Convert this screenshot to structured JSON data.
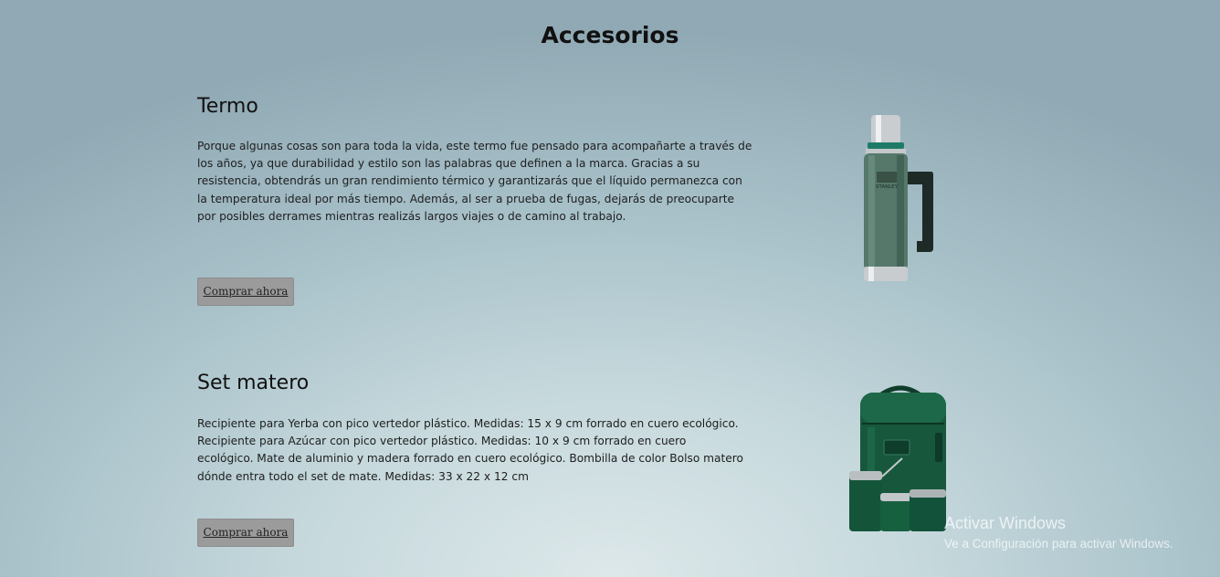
{
  "page": {
    "title": "Accesorios"
  },
  "products": [
    {
      "name": "Termo",
      "description": "Porque algunas cosas son para toda la vida, este termo fue pensado para acompañarte a través de los años, ya que durabilidad y estilo son las palabras que definen a la marca. Gracias a su resistencia, obtendrás un gran rendimiento térmico y garantizarás que el líquido permanezca con la temperatura ideal por más tiempo. Además, al ser a prueba de fugas, dejarás de preocuparte por posibles derrames mientras realizás largos viajes o de camino al trabajo.",
      "button_label": "Comprar ahora",
      "image_icon": "thermos-image",
      "brand_text": "STANLEY"
    },
    {
      "name": "Set matero",
      "description": "Recipiente para Yerba con pico vertedor plástico. Medidas: 15 x 9 cm forrado en cuero ecológico. Recipiente para Azúcar con pico vertedor plástico. Medidas: 10 x 9 cm forrado en cuero ecológico. Mate de aluminio y madera forrado en cuero ecológico. Bombilla de color Bolso matero dónde entra todo el set de mate. Medidas: 33 x 22 x 12 cm",
      "button_label": "Comprar ahora",
      "image_icon": "mate-set-image"
    }
  ],
  "watermark": {
    "title": "Activar Windows",
    "subtitle": "Ve a Configuración para activar Windows."
  },
  "colors": {
    "button_bg": "#9b9b9b",
    "thermos_green": "#4f6e5f",
    "mate_set_green": "#14563c"
  }
}
